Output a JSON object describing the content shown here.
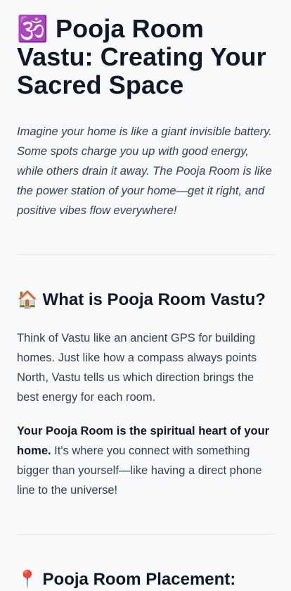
{
  "article": {
    "title": "🕉️ Pooja Room Vastu: Creating Your Sacred Space",
    "intro": "Imagine your home is like a giant invisible battery. Some spots charge you up with good energy, while others drain it away. The Pooja Room is like the power station of your home—get it right, and positive vibes flow everywhere!"
  },
  "section1": {
    "heading": "🏠 What is Pooja Room Vastu?",
    "paragraph1": "Think of Vastu like an ancient GPS for building homes. Just like how a compass always points North, Vastu tells us which direction brings the best energy for each room.",
    "paragraph2_bold": "Your Pooja Room is the spiritual heart of your home.",
    "paragraph2_rest": " It's where you connect with something bigger than yourself—like having a direct phone line to the universe!"
  },
  "section2": {
    "heading": "📍 Pooja Room Placement:"
  }
}
